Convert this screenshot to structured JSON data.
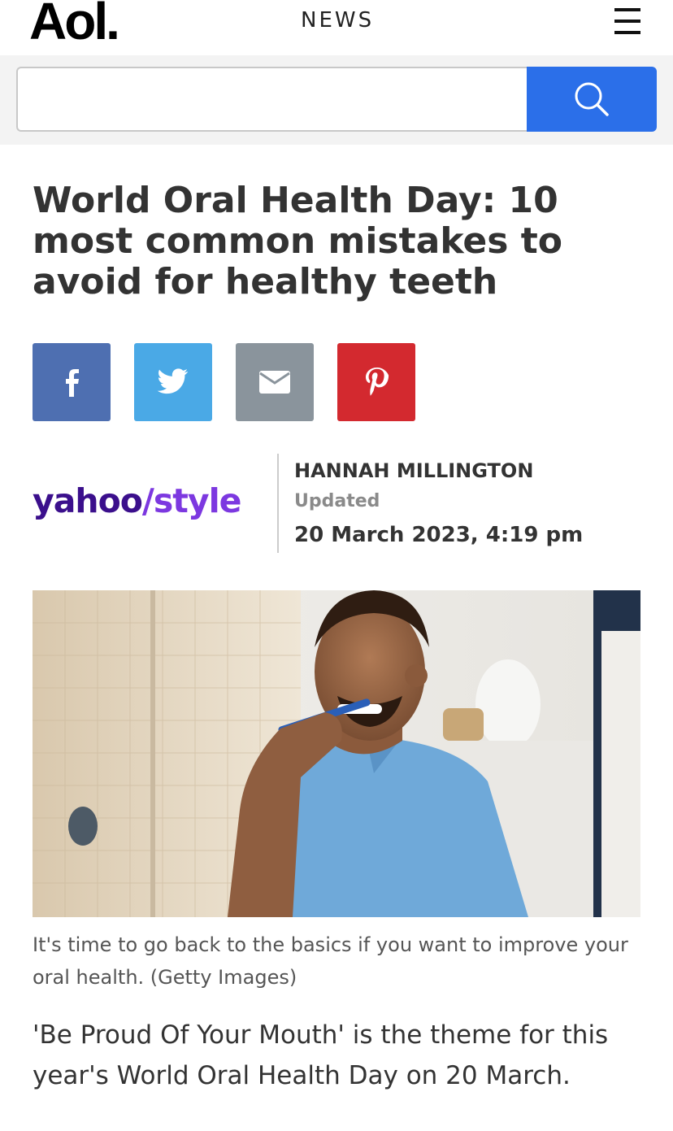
{
  "header": {
    "logo": "Aol.",
    "section": "NEWS",
    "menu_icon": "hamburger-menu-icon"
  },
  "search": {
    "value": "",
    "placeholder": "",
    "button_icon": "search-icon",
    "button_color": "#2b6fe9"
  },
  "article": {
    "headline": "World Oral Health Day: 10 most common mistakes to avoid for healthy teeth",
    "share": [
      {
        "name": "facebook",
        "icon": "facebook-icon",
        "color": "#4e6fb1"
      },
      {
        "name": "twitter",
        "icon": "twitter-icon",
        "color": "#4aa9e6"
      },
      {
        "name": "email",
        "icon": "email-icon",
        "color": "#8a949c"
      },
      {
        "name": "pinterest",
        "icon": "pinterest-icon",
        "color": "#d3292f"
      }
    ],
    "publisher_logo_part1": "yahoo",
    "publisher_logo_part2": "/style",
    "author": "HANNAH MILLINGTON",
    "updated_label": "Updated",
    "date": "20 March 2023, 4:19 pm",
    "image_caption": "It's time to go back to the basics if you want to improve your oral health. (Getty Images)",
    "paragraph1": "'Be Proud Of Your Mouth' is the theme for this year's World Oral Health Day on 20 March."
  }
}
